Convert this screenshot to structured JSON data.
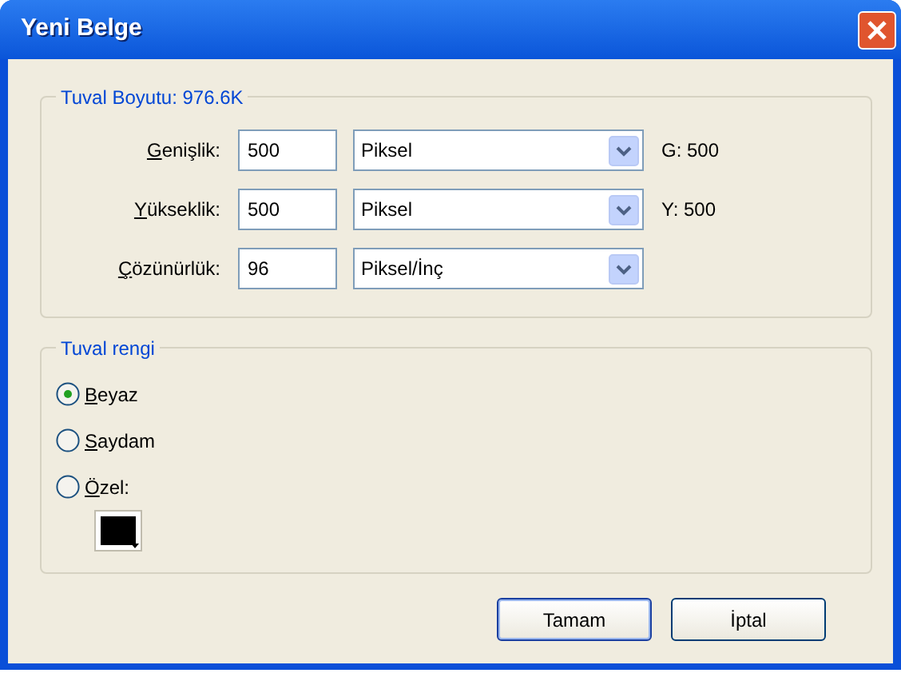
{
  "window": {
    "title": "Yeni Belge"
  },
  "size_group": {
    "legend": "Tuval Boyutu: 976.6K",
    "rows": [
      {
        "label": "Genişlik:",
        "value": "500",
        "unit": "Piksel",
        "reading": "G: 500"
      },
      {
        "label": "Yükseklik:",
        "value": "500",
        "unit": "Piksel",
        "reading": "Y: 500"
      },
      {
        "label": "Çözünürlük:",
        "value": "96",
        "unit": "Piksel/İnç"
      }
    ]
  },
  "color_group": {
    "legend": "Tuval rengi",
    "options": [
      {
        "label": "Beyaz",
        "selected": true
      },
      {
        "label": "Saydam",
        "selected": false
      },
      {
        "label": "Özel:",
        "selected": false
      }
    ],
    "custom_color": {
      "color": "#000000"
    }
  },
  "buttons": [
    {
      "label": "Tamam",
      "default": true
    },
    {
      "label": "İptal",
      "default": false
    }
  ]
}
